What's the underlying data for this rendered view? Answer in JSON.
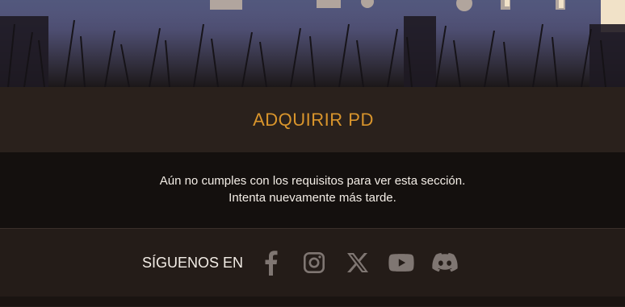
{
  "section": {
    "title": "ADQUIRIR PD"
  },
  "message": {
    "line1": "Aún no cumples con los requisitos para ver esta sección.",
    "line2": "Intenta nuevamente más tarde."
  },
  "social": {
    "label": "SÍGUENOS EN",
    "icons": [
      "facebook-icon",
      "instagram-icon",
      "x-icon",
      "youtube-icon",
      "discord-icon"
    ]
  },
  "colors": {
    "accent": "#d9952c",
    "text": "#f3ede6",
    "icon": "#7f7672",
    "header_bg": "#2a211c",
    "message_bg": "#14100e"
  }
}
